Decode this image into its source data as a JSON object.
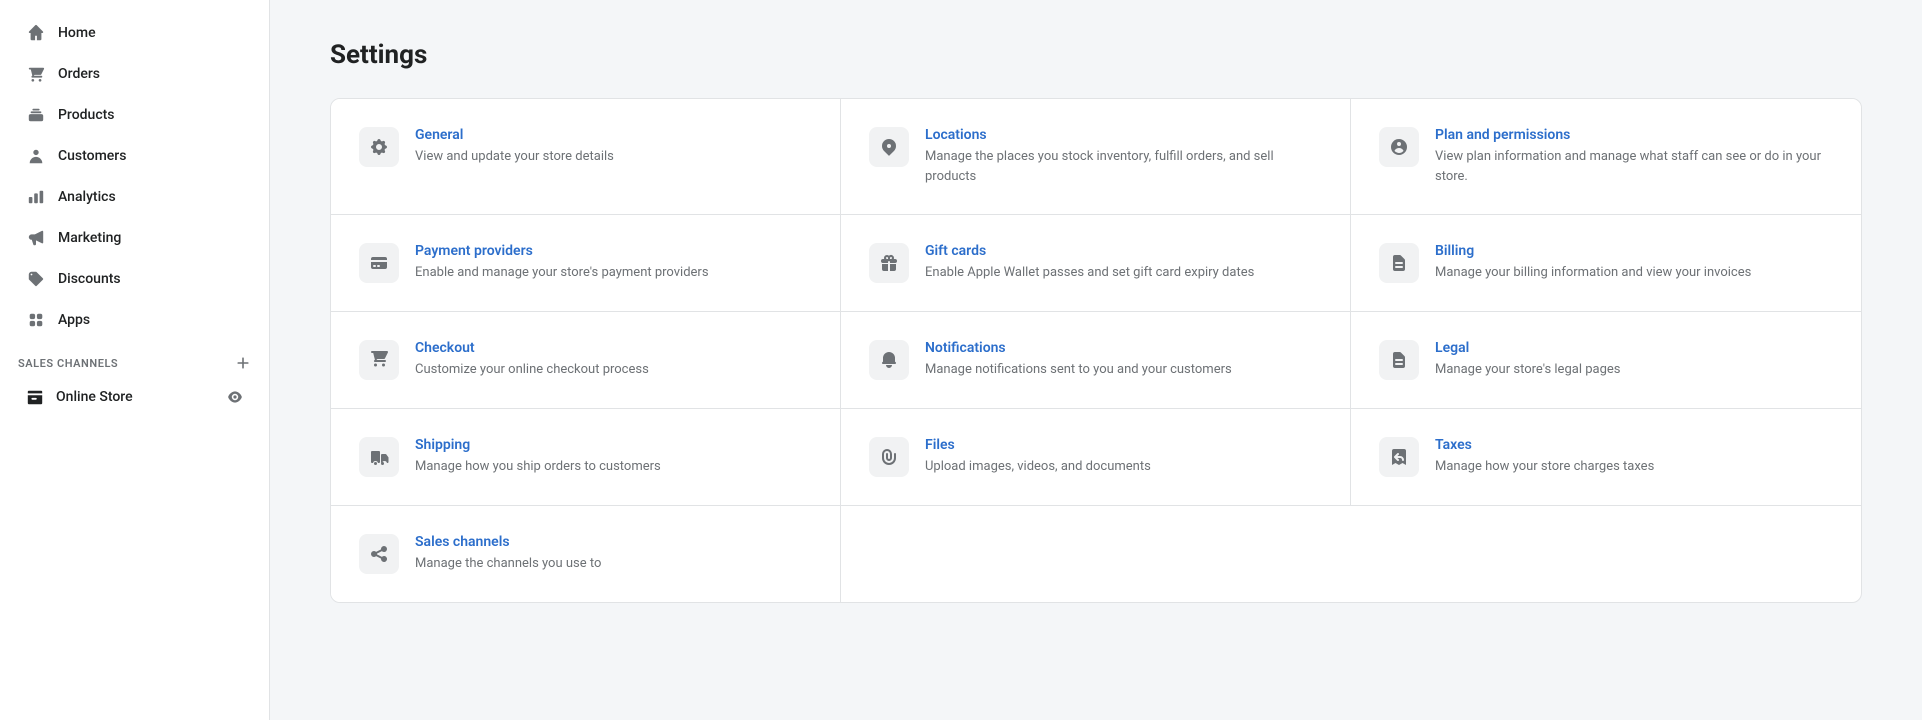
{
  "sidebar": {
    "nav_items": [
      {
        "id": "home",
        "label": "Home",
        "icon": "home"
      },
      {
        "id": "orders",
        "label": "Orders",
        "icon": "orders"
      },
      {
        "id": "products",
        "label": "Products",
        "icon": "products"
      },
      {
        "id": "customers",
        "label": "Customers",
        "icon": "customers"
      },
      {
        "id": "analytics",
        "label": "Analytics",
        "icon": "analytics"
      },
      {
        "id": "marketing",
        "label": "Marketing",
        "icon": "marketing"
      },
      {
        "id": "discounts",
        "label": "Discounts",
        "icon": "discounts"
      },
      {
        "id": "apps",
        "label": "Apps",
        "icon": "apps"
      }
    ],
    "sales_channels_label": "SALES CHANNELS",
    "online_store_label": "Online Store"
  },
  "page": {
    "title": "Settings"
  },
  "settings": {
    "items": [
      {
        "id": "general",
        "title": "General",
        "description": "View and update your store details",
        "icon": "gear"
      },
      {
        "id": "locations",
        "title": "Locations",
        "description": "Manage the places you stock inventory, fulfill orders, and sell products",
        "icon": "location"
      },
      {
        "id": "plan-permissions",
        "title": "Plan and permissions",
        "description": "View plan information and manage what staff can see or do in your store.",
        "icon": "person-circle"
      },
      {
        "id": "payment-providers",
        "title": "Payment providers",
        "description": "Enable and manage your store's payment providers",
        "icon": "payment"
      },
      {
        "id": "gift-cards",
        "title": "Gift cards",
        "description": "Enable Apple Wallet passes and set gift card expiry dates",
        "icon": "gift"
      },
      {
        "id": "billing",
        "title": "Billing",
        "description": "Manage your billing information and view your invoices",
        "icon": "billing"
      },
      {
        "id": "checkout",
        "title": "Checkout",
        "description": "Customize your online checkout process",
        "icon": "checkout"
      },
      {
        "id": "notifications",
        "title": "Notifications",
        "description": "Manage notifications sent to you and your customers",
        "icon": "bell"
      },
      {
        "id": "legal",
        "title": "Legal",
        "description": "Manage your store's legal pages",
        "icon": "legal"
      },
      {
        "id": "shipping",
        "title": "Shipping",
        "description": "Manage how you ship orders to customers",
        "icon": "truck"
      },
      {
        "id": "files",
        "title": "Files",
        "description": "Upload images, videos, and documents",
        "icon": "paperclip"
      },
      {
        "id": "taxes",
        "title": "Taxes",
        "description": "Manage how your store charges taxes",
        "icon": "receipt"
      },
      {
        "id": "sales-channels",
        "title": "Sales channels",
        "description": "Manage the channels you use to",
        "icon": "share"
      }
    ]
  }
}
